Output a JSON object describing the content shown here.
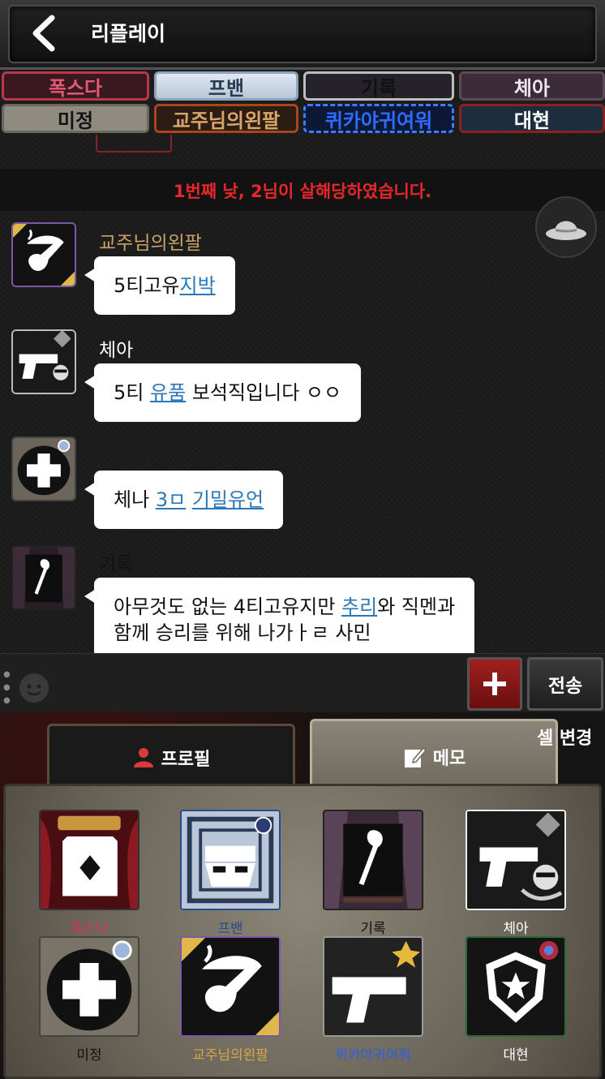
{
  "header": {
    "title": "리플레이",
    "back_icon": "chevron-left-icon"
  },
  "player_tags": [
    "폭스다",
    "프밴",
    "기록",
    "체아",
    "미정",
    "교주님의왼팔",
    "퀴카야귀여워",
    "대현"
  ],
  "system_message": "1번째 낮,  2님이 살해당하였습니다.",
  "messages": [
    {
      "sender": "교주님의왼팔",
      "sender_color": "#c9a266",
      "avatar_icon": "pipe-icon",
      "parts": [
        {
          "text": "5티고유",
          "link": false
        },
        {
          "text": "지박",
          "link": true
        }
      ]
    },
    {
      "sender": "체아",
      "sender_color": "#ffffff",
      "avatar_icon": "pistol-icon",
      "parts": [
        {
          "text": "5티 ",
          "link": false
        },
        {
          "text": "유품",
          "link": true
        },
        {
          "text": " 보석직입니다 ㅇㅇ",
          "link": false
        }
      ]
    },
    {
      "sender": "",
      "sender_color": "#111111",
      "avatar_icon": "medical-cross-icon",
      "parts": [
        {
          "text": "체나 ",
          "link": false
        },
        {
          "text": "3ㅁ",
          "link": true
        },
        {
          "text": " ",
          "link": false
        },
        {
          "text": "기밀유언",
          "link": true
        }
      ]
    },
    {
      "sender": "기록",
      "sender_color": "#111111",
      "avatar_icon": "cane-icon",
      "line1": [
        {
          "text": "아무것도 없는 4티고유지만 ",
          "link": false
        },
        {
          "text": "추리",
          "link": true
        },
        {
          "text": "와 직멘과",
          "link": false
        }
      ],
      "line2": "함께 승리를 위해 나가ㅏㄹ 사민"
    }
  ],
  "input": {
    "plus_icon": "plus-icon",
    "send_label": "전송",
    "emoji_icon": "smiley-icon"
  },
  "tabs": {
    "profile_label": "프로필",
    "memo_label": "메모",
    "cell_change_label": "셀 변경"
  },
  "cards": [
    {
      "name": "폭스다",
      "color": "#d6344e",
      "icon": "diamond-card-icon"
    },
    {
      "name": "프밴",
      "color": "#2a4a8c",
      "icon": "mask-icon"
    },
    {
      "name": "기록",
      "color": "#1a1a1a",
      "icon": "cane-icon"
    },
    {
      "name": "체아",
      "color": "#ffffff",
      "icon": "pistol-icon"
    },
    {
      "name": "미정",
      "color": "#1a1a1a",
      "icon": "medical-cross-icon"
    },
    {
      "name": "교주님의왼팔",
      "color": "#d8a64a",
      "icon": "pipe-icon"
    },
    {
      "name": "퀴카야귀여워",
      "color": "#2d5fe8",
      "icon": "pistol-icon"
    },
    {
      "name": "대현",
      "color": "#ffffff",
      "icon": "police-badge-icon"
    }
  ]
}
